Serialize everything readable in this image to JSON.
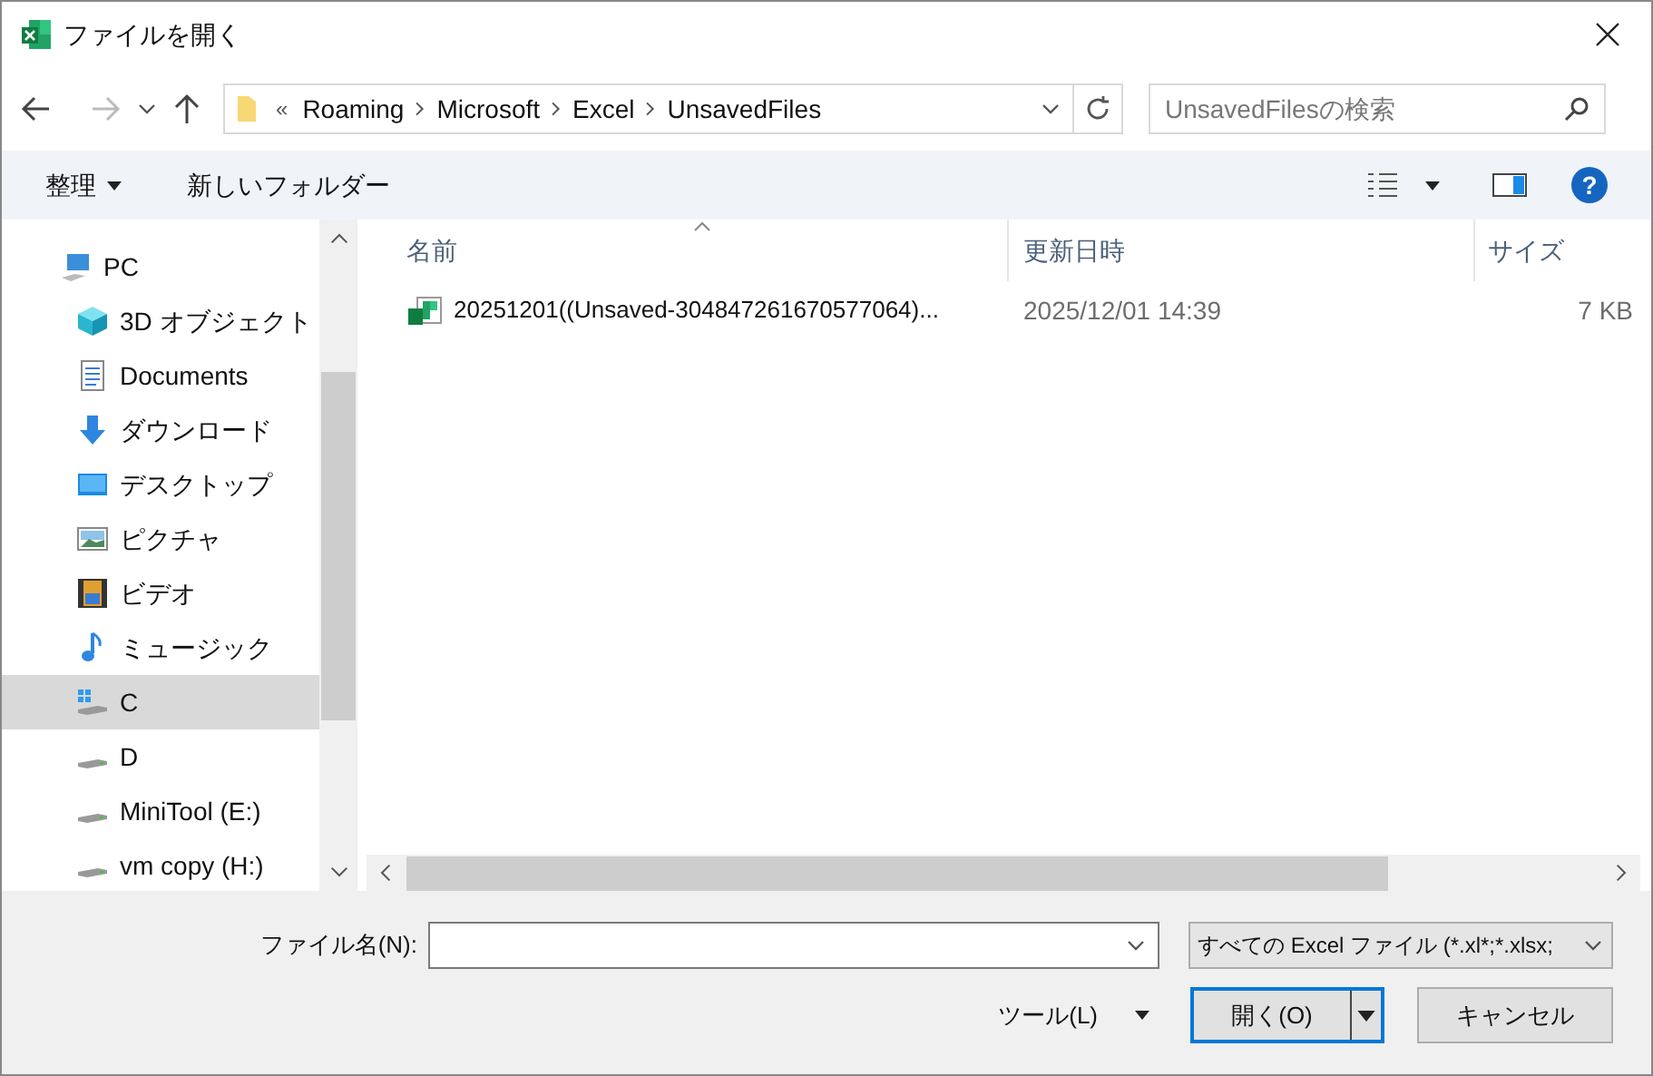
{
  "window": {
    "title": "ファイルを開く"
  },
  "breadcrumb": {
    "overflow": "«",
    "segments": [
      "Roaming",
      "Microsoft",
      "Excel",
      "UnsavedFiles"
    ]
  },
  "search": {
    "placeholder": "UnsavedFilesの検索"
  },
  "toolbar": {
    "organize": "整理",
    "new_folder": "新しいフォルダー",
    "help": "?"
  },
  "sidebar": {
    "items": [
      {
        "label": "PC",
        "kind": "pc",
        "selected": false
      },
      {
        "label": "3D オブジェクト",
        "kind": "cube",
        "selected": false
      },
      {
        "label": "Documents",
        "kind": "document",
        "selected": false
      },
      {
        "label": "ダウンロード",
        "kind": "download",
        "selected": false
      },
      {
        "label": "デスクトップ",
        "kind": "desktop",
        "selected": false
      },
      {
        "label": "ピクチャ",
        "kind": "pictures",
        "selected": false
      },
      {
        "label": "ビデオ",
        "kind": "video",
        "selected": false
      },
      {
        "label": "ミュージック",
        "kind": "music",
        "selected": false
      },
      {
        "label": "C",
        "kind": "system-drive",
        "selected": true
      },
      {
        "label": "D",
        "kind": "drive",
        "selected": false
      },
      {
        "label": "MiniTool (E:)",
        "kind": "drive",
        "selected": false
      },
      {
        "label": "vm copy (H:)",
        "kind": "drive",
        "selected": false
      }
    ]
  },
  "table": {
    "columns": [
      "名前",
      "更新日時",
      "サイズ"
    ],
    "rows": [
      {
        "name": "20251201((Unsaved-304847261670577064)...",
        "modified": "2025/12/01 14:39",
        "size": "7 KB",
        "selected": false
      }
    ]
  },
  "file_name": {
    "label": "ファイル名(N):"
  },
  "file_type": {
    "value": "すべての Excel ファイル (*.xl*;*.xlsx;"
  },
  "buttons": {
    "tools": "ツール(L)",
    "open": "開く(O)",
    "cancel": "キャンセル"
  }
}
